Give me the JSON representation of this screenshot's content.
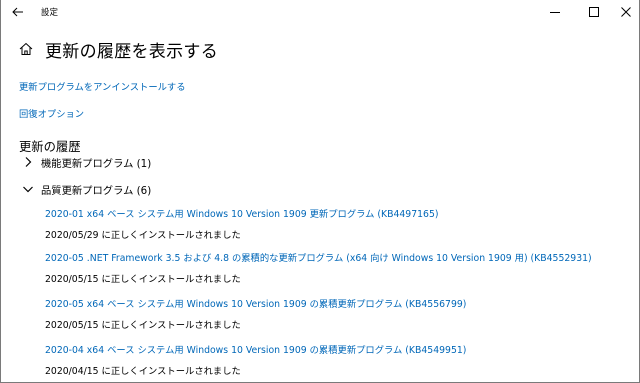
{
  "window": {
    "title": "設定",
    "minimize_glyph": "─",
    "maximize_glyph": "☐",
    "close_glyph": "✕"
  },
  "page": {
    "title": "更新の履歴を表示する"
  },
  "links": {
    "uninstall": "更新プログラムをアンインストールする",
    "recovery": "回復オプション"
  },
  "history": {
    "heading": "更新の履歴",
    "groups": [
      {
        "label": "機能更新プログラム (1)",
        "expanded": false
      },
      {
        "label": "品質更新プログラム (6)",
        "expanded": true
      }
    ],
    "quality_updates": [
      {
        "title": "2020-01 x64 ベース システム用 Windows 10 Version 1909 更新プログラム (KB4497165)",
        "status": "2020/05/29 に正しくインストールされました"
      },
      {
        "title": "2020-05 .NET Framework 3.5 および 4.8 の累積的な更新プログラム (x64 向け Windows 10 Version 1909 用) (KB4552931)",
        "status": "2020/05/15 に正しくインストールされました"
      },
      {
        "title": "2020-05 x64 ベース システム用 Windows 10 Version 1909 の累積更新プログラム (KB4556799)",
        "status": "2020/05/15 に正しくインストールされました"
      },
      {
        "title": "2020-04 x64 ベース システム用 Windows 10 Version 1909 の累積更新プログラム (KB4549951)",
        "status": "2020/04/15 に正しくインストールされました"
      }
    ]
  },
  "icons": {
    "back": "back-arrow-icon",
    "home": "home-icon",
    "collapsed": "chevron-right-icon",
    "expanded": "chevron-down-icon"
  },
  "colors": {
    "link": "#0067b8",
    "text": "#000000",
    "background": "#ffffff"
  }
}
